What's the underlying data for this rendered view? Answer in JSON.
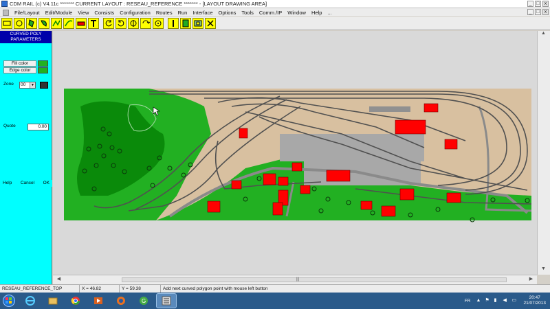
{
  "window": {
    "title": "CDM RAIL (c) V4.11c        ******* CURRENT LAYOUT : RESEAU_REFERENCE ******* - [LAYOUT DRAWING AREA]",
    "btn_min": "_",
    "btn_max": "□",
    "btn_close": "x"
  },
  "menu": {
    "items": [
      "File/Layout",
      "Edit/Module",
      "View",
      "Consists",
      "Configuration",
      "Routes",
      "Run",
      "Interface",
      "Options",
      "Tools",
      "Comm./IP",
      "Window",
      "Help",
      "..."
    ]
  },
  "panel": {
    "header_line1": "CURVED POLY",
    "header_line2": "PARAMETERS",
    "fill_color_label": "Fill color",
    "edge_color_label": "Edge color",
    "fill_color": "#22b022",
    "edge_color": "#22b022",
    "zone_label": "Zone",
    "zone_value": "00",
    "quote_label": "Quote",
    "quote_value": "0.00",
    "help_label": "Help",
    "cancel_label": "Cancel",
    "ok_label": "OK"
  },
  "status": {
    "layout": "RESEAU_REFERENCE_TOP",
    "x_label": "X =",
    "x_value": "46.82",
    "y_label": "Y =",
    "y_value": "59.38",
    "message": "Add next curved polygon point with mouse left button"
  },
  "taskbar": {
    "lang": "FR",
    "time": "20:47",
    "date": "21/07/2013"
  },
  "colors": {
    "panel_bg": "#00ffff",
    "panel_header": "#0000aa",
    "grass": "#22b022",
    "dark_grass": "#0a8a0a",
    "sand": "#d8c0a0",
    "building": "#ff0000",
    "rail": "#505050"
  }
}
